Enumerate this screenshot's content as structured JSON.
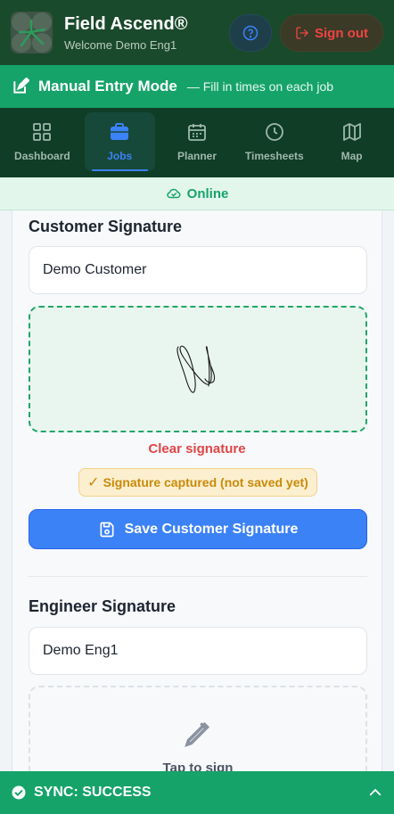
{
  "header": {
    "title": "Field Ascend®",
    "subtitle": "Welcome Demo Eng1",
    "help_icon": "question-circle-icon",
    "signout_label": "Sign out"
  },
  "manual_banner": {
    "title": "Manual Entry Mode",
    "subtitle": "— Fill in times on each job"
  },
  "nav": {
    "items": [
      {
        "label": "Dashboard",
        "icon": "grid-icon"
      },
      {
        "label": "Jobs",
        "icon": "briefcase-icon",
        "active": true
      },
      {
        "label": "Planner",
        "icon": "calendar-icon"
      },
      {
        "label": "Timesheets",
        "icon": "clock-icon"
      },
      {
        "label": "Map",
        "icon": "map-icon"
      }
    ]
  },
  "status": {
    "online_label": "Online"
  },
  "customer_signature": {
    "title": "Customer Signature",
    "name_value": "Demo Customer",
    "clear_label": "Clear signature",
    "captured_label": "Signature captured (not saved yet)",
    "save_label": "Save Customer Signature"
  },
  "engineer_signature": {
    "title": "Engineer Signature",
    "name_value": "Demo Eng1",
    "tap_label": "Tap to sign"
  },
  "sync": {
    "label": "SYNC: SUCCESS"
  },
  "colors": {
    "header_bg": "#1a4a2c",
    "accent_green": "#16a36a",
    "nav_bg": "#0f3d26",
    "primary_blue": "#3b82f6",
    "danger_red": "#e04545",
    "warning_amber": "#c98a0a"
  }
}
